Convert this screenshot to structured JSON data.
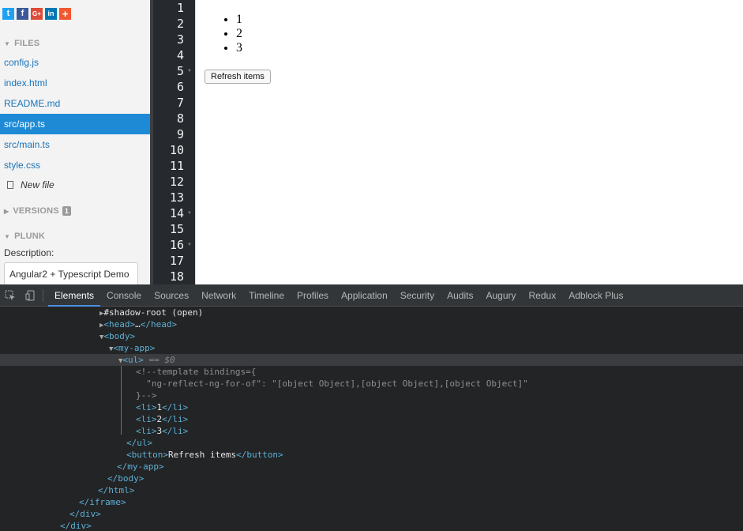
{
  "social": [
    {
      "icon": "twitter-icon",
      "glyph": "t",
      "color": "#1da1f2"
    },
    {
      "icon": "facebook-icon",
      "glyph": "f",
      "color": "#3b5998"
    },
    {
      "icon": "google-plus-icon",
      "glyph": "G+",
      "color": "#dd4b39"
    },
    {
      "icon": "linkedin-icon",
      "glyph": "in",
      "color": "#0077b5"
    },
    {
      "icon": "plus-icon",
      "glyph": "+",
      "color": "#f0582f"
    }
  ],
  "sidebar": {
    "files_header": "FILES",
    "files": [
      "config.js",
      "index.html",
      "README.md",
      "src/app.ts",
      "src/main.ts",
      "style.css"
    ],
    "active_file": "src/app.ts",
    "new_file": "New file",
    "versions_header": "VERSIONS",
    "versions_count": "1",
    "plunk_header": "PLUNK",
    "description_label": "Description:",
    "description_value": "Angular2 + Typescript Demo"
  },
  "editor": {
    "line_numbers": [
      "1",
      "2",
      "3",
      "4",
      "5",
      "6",
      "7",
      "8",
      "9",
      "10",
      "11",
      "12",
      "13",
      "14",
      "15",
      "16",
      "17",
      "18"
    ]
  },
  "preview": {
    "items": [
      "1",
      "2",
      "3"
    ],
    "button_label": "Refresh items"
  },
  "devtools": {
    "tabs": [
      "Elements",
      "Console",
      "Sources",
      "Network",
      "Timeline",
      "Profiles",
      "Application",
      "Security",
      "Audits",
      "Augury",
      "Redux",
      "Adblock Plus"
    ],
    "active_tab": "Elements",
    "dom": {
      "shadow_root": "#shadow-root (open)",
      "head_open": "<head>",
      "head_ellipsis": "…",
      "head_close": "</head>",
      "body_open": "<body>",
      "my_app_open": "<my-app>",
      "ul_open": "<ul>",
      "ul_marker": " == $0",
      "comment_1": "<!--template bindings={",
      "comment_2": "  \"ng-reflect-ng-for-of\": \"[object Object],[object Object],[object Object]\"",
      "comment_3": "}-->",
      "li_open": "<li>",
      "li_close": "</li>",
      "li_values": [
        "1",
        "2",
        "3"
      ],
      "ul_close": "</ul>",
      "button_open": "<button>",
      "button_text": "Refresh items",
      "button_close": "</button>",
      "my_app_close": "</my-app>",
      "body_close": "</body>",
      "html_close": "</html>",
      "iframe_close": "</iframe>",
      "div_close": "</div>"
    }
  }
}
